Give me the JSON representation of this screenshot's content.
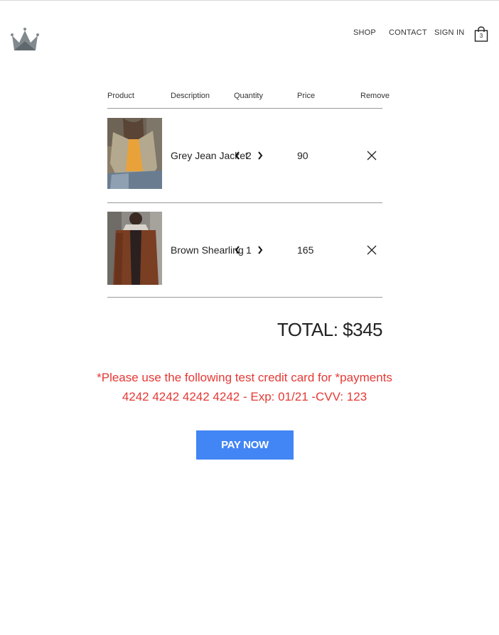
{
  "nav": {
    "links": [
      "SHOP",
      "CONTACT",
      "SIGN IN"
    ],
    "cart_count": "3"
  },
  "table": {
    "headers": [
      "Product",
      "Description",
      "Quantity",
      "Price",
      "Remove"
    ],
    "items": [
      {
        "description": "Grey Jean Jacket",
        "quantity": "2",
        "price": "90"
      },
      {
        "description": "Brown Shearling",
        "quantity": "1",
        "price": "165"
      }
    ]
  },
  "total": "TOTAL: $345",
  "notice": {
    "line1": "*Please use the following test credit card for *payments",
    "line2": "4242 4242 4242 4242 - Exp: 01/21 -CVV: 123"
  },
  "pay_button": "PAY NOW",
  "colors": {
    "accent": "#4285f4",
    "notice": "#e53935"
  }
}
